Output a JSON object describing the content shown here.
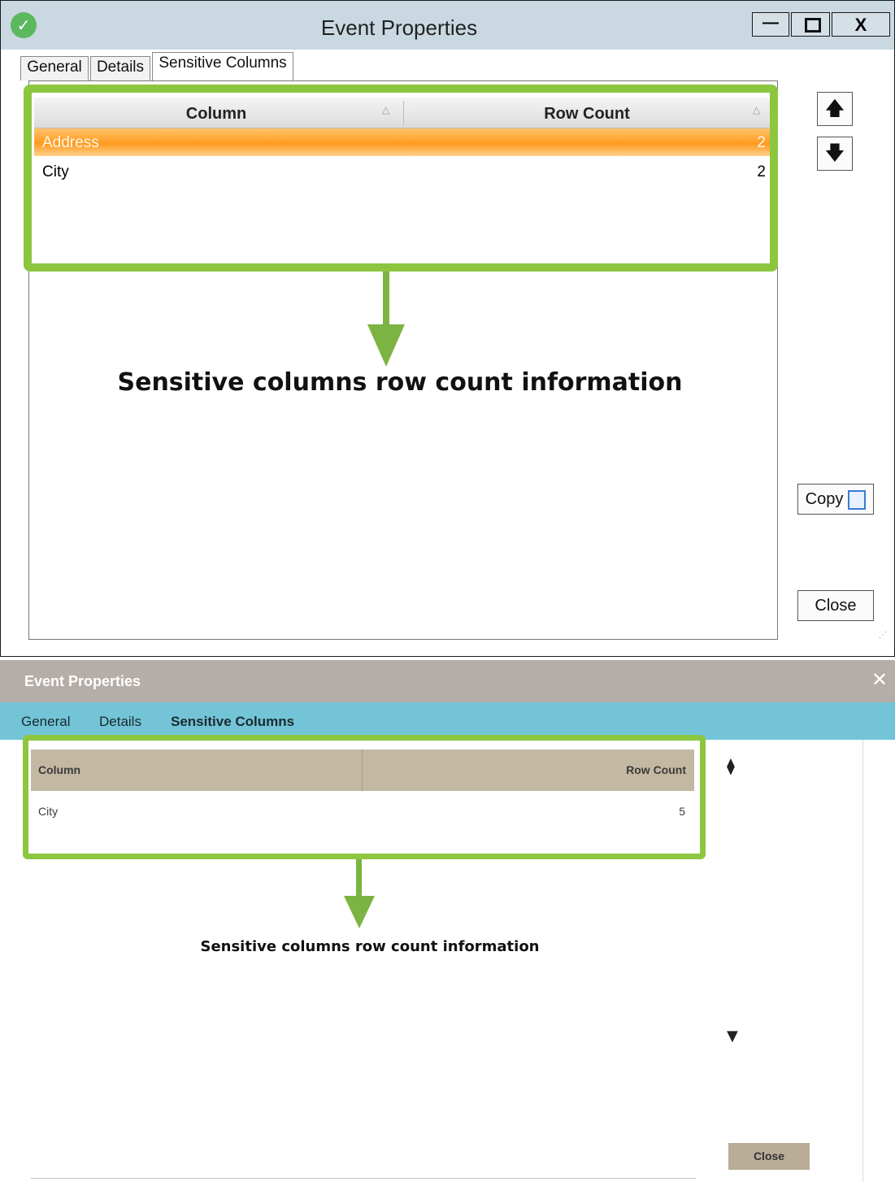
{
  "classic": {
    "title": "Event Properties",
    "window_buttons": {
      "minimize": "—",
      "close": "X"
    },
    "tabs": [
      "General",
      "Details",
      "Sensitive Columns"
    ],
    "active_tab": "Sensitive Columns",
    "grid": {
      "columns": [
        "Column",
        "Row Count"
      ],
      "sort_glyph": "△",
      "rows": [
        {
          "column": "Address",
          "row_count": "2",
          "selected": true
        },
        {
          "column": "City",
          "row_count": "2",
          "selected": false
        }
      ]
    },
    "caption": "Sensitive columns row count information",
    "buttons": {
      "up": "🡅",
      "down": "🡇",
      "copy": "Copy",
      "close": "Close"
    },
    "icons": [
      "check-circle-icon",
      "arrow-up-icon",
      "arrow-down-icon",
      "copy-icon",
      "resize-grip-icon"
    ],
    "colors": {
      "selected_row": "#ff9a1e",
      "highlight": "#8cc63f"
    }
  },
  "web": {
    "title": "Event Properties",
    "close_glyph": "✕",
    "tabs": [
      "General",
      "Details",
      "Sensitive Columns"
    ],
    "active_tab": "Sensitive Columns",
    "grid": {
      "columns": [
        "Column",
        "Row Count"
      ],
      "rows": [
        {
          "column": "City",
          "row_count": "5"
        }
      ]
    },
    "caption": "Sensitive columns row count information",
    "buttons": {
      "up": "⧫",
      "down": "▼",
      "close": "Close"
    },
    "colors": {
      "titlebar": "#b5ada7",
      "tabbar": "#72c4d6",
      "header": "#c3b8a2",
      "highlight": "#8cc63f"
    }
  }
}
